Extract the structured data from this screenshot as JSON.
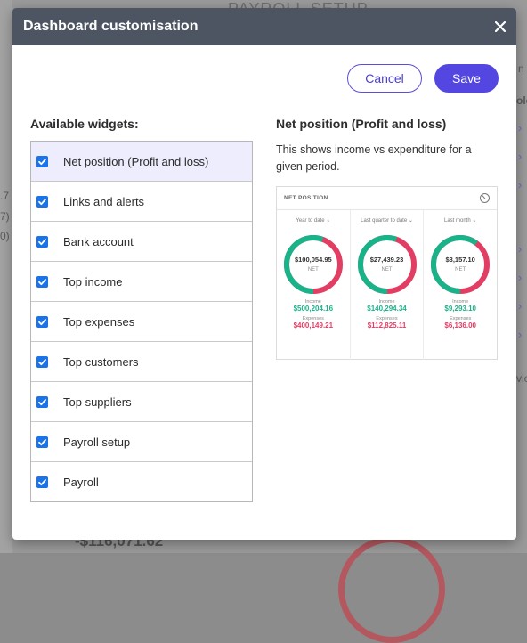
{
  "background": {
    "heading": "PAYROLL SETUP",
    "snippet_right": "n i",
    "snippet_right2": "ole",
    "snippet_right3": "vic",
    "left_values": [
      ".7",
      "7)",
      "0)"
    ],
    "bottom_value": "-$116,071.62"
  },
  "modal": {
    "title": "Dashboard customisation",
    "close_icon": "close-icon",
    "cancel_label": "Cancel",
    "save_label": "Save",
    "accent_color": "#5446e0"
  },
  "widgets": {
    "title": "Available widgets:",
    "items": [
      {
        "label": "Net position (Profit and loss)",
        "checked": true,
        "selected": true
      },
      {
        "label": "Links and alerts",
        "checked": true
      },
      {
        "label": "Bank account",
        "checked": true
      },
      {
        "label": "Top income",
        "checked": true
      },
      {
        "label": "Top expenses",
        "checked": true
      },
      {
        "label": "Top customers",
        "checked": true
      },
      {
        "label": "Top suppliers",
        "checked": true
      },
      {
        "label": "Payroll setup",
        "checked": true
      },
      {
        "label": "Payroll",
        "checked": true
      }
    ]
  },
  "detail": {
    "title": "Net position (Profit and loss)",
    "description": "This shows income vs expenditure for a given period.",
    "preview": {
      "title": "NET POSITION",
      "settings_icon": "settings-icon",
      "columns": [
        {
          "period": "Year to date",
          "net": "$100,054.95",
          "net_label": "NET",
          "income_label": "Income",
          "income": "$500,204.16",
          "expenses_label": "Expenses",
          "expenses": "$400,149.21",
          "income_share": 0.556
        },
        {
          "period": "Last quarter to date",
          "net": "$27,439.23",
          "net_label": "NET",
          "income_label": "Income",
          "income": "$140,294.34",
          "expenses_label": "Expenses",
          "expenses": "$112,825.11",
          "income_share": 0.554
        },
        {
          "period": "Last month",
          "net": "$3,157.10",
          "net_label": "NET",
          "income_label": "Income",
          "income": "$9,293.10",
          "expenses_label": "Expenses",
          "expenses": "$6,136.00",
          "income_share": 0.602
        }
      ],
      "income_color": "#19b38a",
      "expense_color": "#e23d63"
    }
  }
}
